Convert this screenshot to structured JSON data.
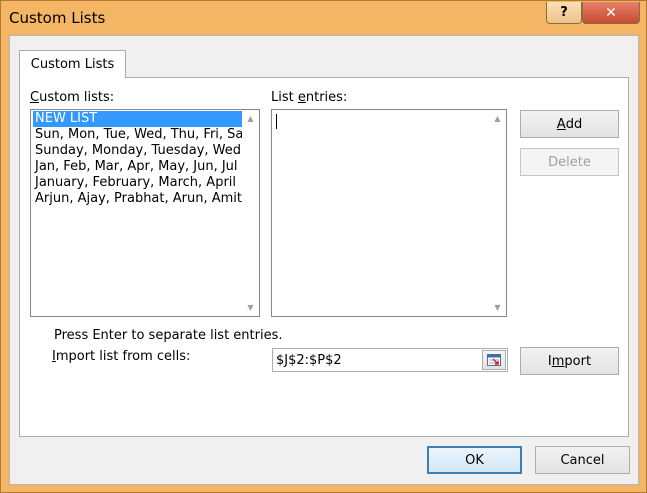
{
  "window": {
    "title": "Custom Lists",
    "help_label": "?",
    "close_label": "✕"
  },
  "tab": {
    "label": "Custom Lists"
  },
  "custom_lists": {
    "label_pre": "",
    "label_u": "C",
    "label_post": "ustom lists:",
    "items": [
      "NEW LIST",
      "Sun, Mon, Tue, Wed, Thu, Fri, Sat",
      "Sunday, Monday, Tuesday, Wednesday",
      "Jan, Feb, Mar, Apr, May, Jun, Jul",
      "January, February, March, April",
      "Arjun, Ajay, Prabhat, Arun, Amit"
    ],
    "selected_index": 0
  },
  "list_entries": {
    "label_pre": "List ",
    "label_u": "e",
    "label_post": "ntries:",
    "value": ""
  },
  "buttons": {
    "add_u": "A",
    "add_post": "dd",
    "delete": "Delete",
    "import_pre": "I",
    "import_u": "m",
    "import_post": "port",
    "ok": "OK",
    "cancel": "Cancel"
  },
  "hint": "Press Enter to separate list entries.",
  "import": {
    "label_pre": "",
    "label_u": "I",
    "label_post": "mport list from cells:",
    "value": "$J$2:$P$2"
  },
  "colors": {
    "title_bar": "#f4b664",
    "selection": "#3399ff",
    "close_button": "#c64a33",
    "ok_border": "#3c7fb1"
  },
  "icons": {
    "collapse": "range-selector-icon"
  }
}
